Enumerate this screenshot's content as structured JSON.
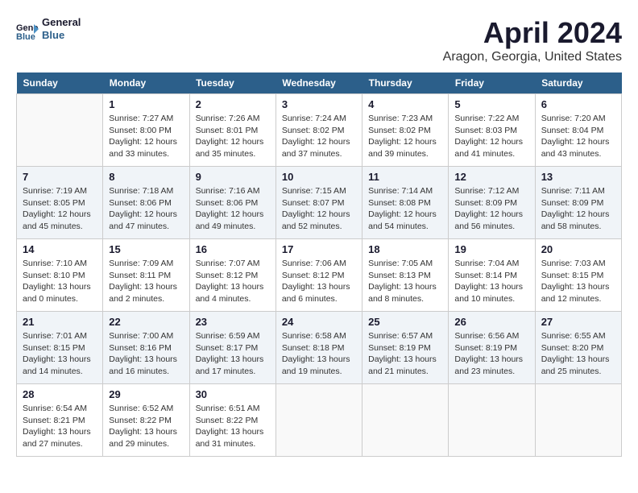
{
  "header": {
    "logo_line1": "General",
    "logo_line2": "Blue",
    "title": "April 2024",
    "subtitle": "Aragon, Georgia, United States"
  },
  "columns": [
    "Sunday",
    "Monday",
    "Tuesday",
    "Wednesday",
    "Thursday",
    "Friday",
    "Saturday"
  ],
  "weeks": [
    [
      {
        "day": "",
        "info": ""
      },
      {
        "day": "1",
        "info": "Sunrise: 7:27 AM\nSunset: 8:00 PM\nDaylight: 12 hours\nand 33 minutes."
      },
      {
        "day": "2",
        "info": "Sunrise: 7:26 AM\nSunset: 8:01 PM\nDaylight: 12 hours\nand 35 minutes."
      },
      {
        "day": "3",
        "info": "Sunrise: 7:24 AM\nSunset: 8:02 PM\nDaylight: 12 hours\nand 37 minutes."
      },
      {
        "day": "4",
        "info": "Sunrise: 7:23 AM\nSunset: 8:02 PM\nDaylight: 12 hours\nand 39 minutes."
      },
      {
        "day": "5",
        "info": "Sunrise: 7:22 AM\nSunset: 8:03 PM\nDaylight: 12 hours\nand 41 minutes."
      },
      {
        "day": "6",
        "info": "Sunrise: 7:20 AM\nSunset: 8:04 PM\nDaylight: 12 hours\nand 43 minutes."
      }
    ],
    [
      {
        "day": "7",
        "info": "Sunrise: 7:19 AM\nSunset: 8:05 PM\nDaylight: 12 hours\nand 45 minutes."
      },
      {
        "day": "8",
        "info": "Sunrise: 7:18 AM\nSunset: 8:06 PM\nDaylight: 12 hours\nand 47 minutes."
      },
      {
        "day": "9",
        "info": "Sunrise: 7:16 AM\nSunset: 8:06 PM\nDaylight: 12 hours\nand 49 minutes."
      },
      {
        "day": "10",
        "info": "Sunrise: 7:15 AM\nSunset: 8:07 PM\nDaylight: 12 hours\nand 52 minutes."
      },
      {
        "day": "11",
        "info": "Sunrise: 7:14 AM\nSunset: 8:08 PM\nDaylight: 12 hours\nand 54 minutes."
      },
      {
        "day": "12",
        "info": "Sunrise: 7:12 AM\nSunset: 8:09 PM\nDaylight: 12 hours\nand 56 minutes."
      },
      {
        "day": "13",
        "info": "Sunrise: 7:11 AM\nSunset: 8:09 PM\nDaylight: 12 hours\nand 58 minutes."
      }
    ],
    [
      {
        "day": "14",
        "info": "Sunrise: 7:10 AM\nSunset: 8:10 PM\nDaylight: 13 hours\nand 0 minutes."
      },
      {
        "day": "15",
        "info": "Sunrise: 7:09 AM\nSunset: 8:11 PM\nDaylight: 13 hours\nand 2 minutes."
      },
      {
        "day": "16",
        "info": "Sunrise: 7:07 AM\nSunset: 8:12 PM\nDaylight: 13 hours\nand 4 minutes."
      },
      {
        "day": "17",
        "info": "Sunrise: 7:06 AM\nSunset: 8:12 PM\nDaylight: 13 hours\nand 6 minutes."
      },
      {
        "day": "18",
        "info": "Sunrise: 7:05 AM\nSunset: 8:13 PM\nDaylight: 13 hours\nand 8 minutes."
      },
      {
        "day": "19",
        "info": "Sunrise: 7:04 AM\nSunset: 8:14 PM\nDaylight: 13 hours\nand 10 minutes."
      },
      {
        "day": "20",
        "info": "Sunrise: 7:03 AM\nSunset: 8:15 PM\nDaylight: 13 hours\nand 12 minutes."
      }
    ],
    [
      {
        "day": "21",
        "info": "Sunrise: 7:01 AM\nSunset: 8:15 PM\nDaylight: 13 hours\nand 14 minutes."
      },
      {
        "day": "22",
        "info": "Sunrise: 7:00 AM\nSunset: 8:16 PM\nDaylight: 13 hours\nand 16 minutes."
      },
      {
        "day": "23",
        "info": "Sunrise: 6:59 AM\nSunset: 8:17 PM\nDaylight: 13 hours\nand 17 minutes."
      },
      {
        "day": "24",
        "info": "Sunrise: 6:58 AM\nSunset: 8:18 PM\nDaylight: 13 hours\nand 19 minutes."
      },
      {
        "day": "25",
        "info": "Sunrise: 6:57 AM\nSunset: 8:19 PM\nDaylight: 13 hours\nand 21 minutes."
      },
      {
        "day": "26",
        "info": "Sunrise: 6:56 AM\nSunset: 8:19 PM\nDaylight: 13 hours\nand 23 minutes."
      },
      {
        "day": "27",
        "info": "Sunrise: 6:55 AM\nSunset: 8:20 PM\nDaylight: 13 hours\nand 25 minutes."
      }
    ],
    [
      {
        "day": "28",
        "info": "Sunrise: 6:54 AM\nSunset: 8:21 PM\nDaylight: 13 hours\nand 27 minutes."
      },
      {
        "day": "29",
        "info": "Sunrise: 6:52 AM\nSunset: 8:22 PM\nDaylight: 13 hours\nand 29 minutes."
      },
      {
        "day": "30",
        "info": "Sunrise: 6:51 AM\nSunset: 8:22 PM\nDaylight: 13 hours\nand 31 minutes."
      },
      {
        "day": "",
        "info": ""
      },
      {
        "day": "",
        "info": ""
      },
      {
        "day": "",
        "info": ""
      },
      {
        "day": "",
        "info": ""
      }
    ]
  ]
}
